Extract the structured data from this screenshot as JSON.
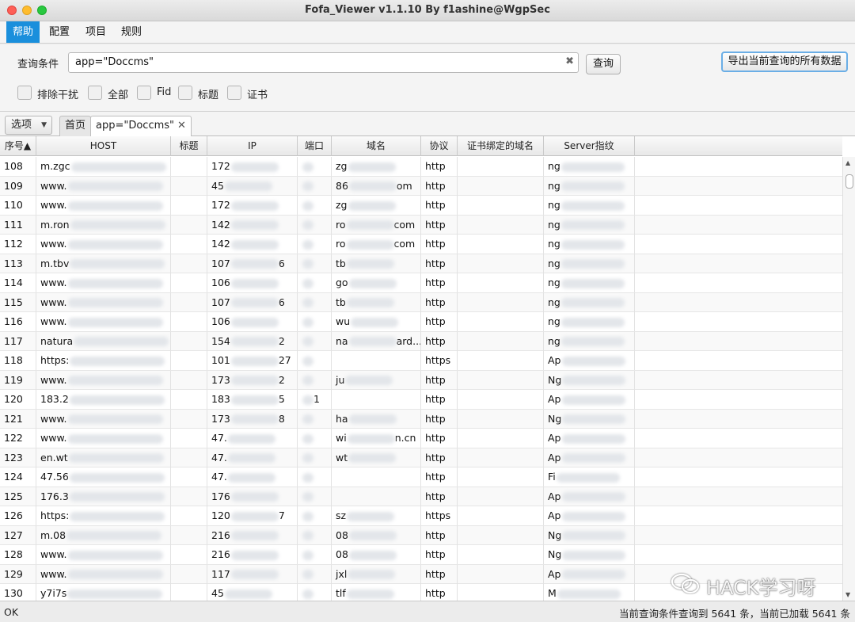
{
  "window": {
    "title": "Fofa_Viewer v1.1.10 By f1ashine@WgpSec"
  },
  "menu": [
    "帮助",
    "配置",
    "项目",
    "规则"
  ],
  "query": {
    "label": "查询条件",
    "value": "app=\"Doccms\"",
    "query_button": "查询",
    "export_button": "导出当前查询的所有数据"
  },
  "filters": [
    "排除干扰",
    "全部",
    "Fid",
    "标题",
    "证书"
  ],
  "tabs": {
    "options": "选项",
    "home": "首页",
    "query_tab": "app=\"Doccms\""
  },
  "table": {
    "columns": [
      "序号▲",
      "HOST",
      "标题",
      "IP",
      "端口",
      "域名",
      "协议",
      "证书绑定的域名",
      "Server指纹"
    ],
    "rows": [
      {
        "no": "108",
        "host": "m.zgc",
        "ip": "172",
        "port": "",
        "domain": "zg",
        "proto": "http",
        "server": "ng"
      },
      {
        "no": "109",
        "host": "www.",
        "ip": "45",
        "port": "",
        "domain": "86",
        "domain_tail": "om",
        "proto": "http",
        "server": "ng"
      },
      {
        "no": "110",
        "host": "www.",
        "ip": "172",
        "port": "",
        "domain": "zg",
        "proto": "http",
        "server": "ng"
      },
      {
        "no": "111",
        "host": "m.ron",
        "ip": "142",
        "port": "",
        "domain": "ro",
        "domain_tail": "com",
        "proto": "http",
        "server": "ng"
      },
      {
        "no": "112",
        "host": "www.",
        "ip": "142",
        "port": "",
        "domain": "ro",
        "domain_tail": "com",
        "proto": "http",
        "server": "ng"
      },
      {
        "no": "113",
        "host": "m.tbv",
        "ip": "107",
        "ip_tail": "6",
        "port": "",
        "domain": "tb",
        "proto": "http",
        "server": "ng"
      },
      {
        "no": "114",
        "host": "www.",
        "ip": "106",
        "port": "",
        "domain": "go",
        "proto": "http",
        "server": "ng"
      },
      {
        "no": "115",
        "host": "www.",
        "ip": "107",
        "ip_tail": "6",
        "port": "",
        "domain": "tb",
        "proto": "http",
        "server": "ng"
      },
      {
        "no": "116",
        "host": "www.",
        "ip": "106",
        "port": "",
        "domain": "wu",
        "proto": "http",
        "server": "ng"
      },
      {
        "no": "117",
        "host": "natura",
        "ip": "154",
        "ip_tail": "2",
        "port": "",
        "domain": "na",
        "domain_tail": "ard...",
        "proto": "http",
        "server": "ng"
      },
      {
        "no": "118",
        "host": "https:",
        "ip": "101",
        "ip_tail": "27",
        "port": "",
        "domain": "",
        "proto": "https",
        "server": "Ap"
      },
      {
        "no": "119",
        "host": "www.",
        "ip": "173",
        "ip_tail": "2",
        "port": "",
        "domain": "ju",
        "proto": "http",
        "server": "Ng"
      },
      {
        "no": "120",
        "host": "183.2",
        "ip": "183",
        "ip_tail": "5",
        "port": "",
        "port_tail": "1",
        "domain": "",
        "proto": "http",
        "server": "Ap"
      },
      {
        "no": "121",
        "host": "www.",
        "ip": "173",
        "ip_tail": "8",
        "port": "",
        "domain": "ha",
        "proto": "http",
        "server": "Ng"
      },
      {
        "no": "122",
        "host": "www.",
        "ip": "47.",
        "port": "",
        "domain": "wi",
        "domain_tail": "n.cn",
        "proto": "http",
        "server": "Ap"
      },
      {
        "no": "123",
        "host": "en.wt",
        "ip": "47.",
        "port": "",
        "domain": "wt",
        "proto": "http",
        "server": "Ap"
      },
      {
        "no": "124",
        "host": "47.56",
        "ip": "47.",
        "port": "",
        "domain": "",
        "proto": "http",
        "server": "Fi"
      },
      {
        "no": "125",
        "host": "176.3",
        "ip": "176",
        "port": "",
        "domain": "",
        "proto": "http",
        "server": "Ap"
      },
      {
        "no": "126",
        "host": "https:",
        "ip": "120",
        "ip_tail": "7",
        "port": "",
        "domain": "sz",
        "proto": "https",
        "server": "Ap"
      },
      {
        "no": "127",
        "host": "m.08",
        "ip": "216",
        "port": "",
        "domain": "08",
        "proto": "http",
        "server": "Ng"
      },
      {
        "no": "128",
        "host": "www.",
        "ip": "216",
        "port": "",
        "domain": "08",
        "proto": "http",
        "server": "Ng"
      },
      {
        "no": "129",
        "host": "www.",
        "ip": "117",
        "port": "",
        "domain": "jxl",
        "proto": "http",
        "server": "Ap"
      },
      {
        "no": "130",
        "host": "y7i7s",
        "ip": "45",
        "port": "",
        "domain": "tlf",
        "proto": "http",
        "server": "M"
      }
    ]
  },
  "watermark": "HACK学习呀",
  "status": {
    "left": "OK",
    "right": "当前查询条件查询到 5641 条，当前已加载 5641 条"
  }
}
